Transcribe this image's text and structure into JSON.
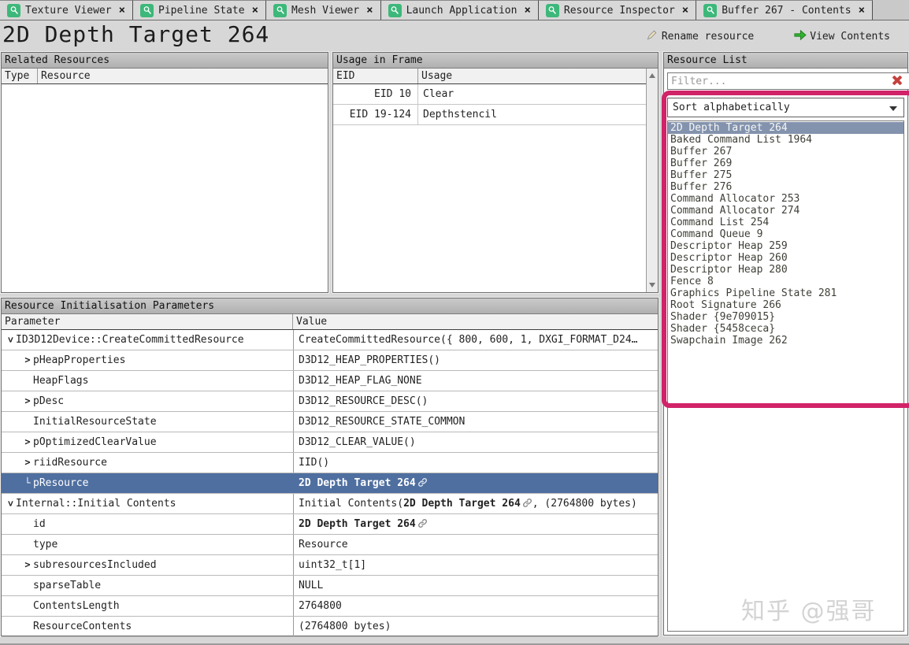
{
  "window": {
    "tabs": [
      {
        "label": "Texture Viewer"
      },
      {
        "label": "Pipeline State"
      },
      {
        "label": "Mesh Viewer"
      },
      {
        "label": "Launch Application"
      },
      {
        "label": "Resource Inspector"
      },
      {
        "label": "Buffer 267 - Contents"
      }
    ],
    "close_glyph": "×"
  },
  "header": {
    "title": "2D Depth Target 264",
    "rename_label": "Rename resource",
    "view_label": "View Contents"
  },
  "related_resources": {
    "title": "Related Resources",
    "columns": [
      "Type",
      "Resource"
    ],
    "rows": []
  },
  "usage_in_frame": {
    "title": "Usage in Frame",
    "columns": [
      "EID",
      "Usage"
    ],
    "rows": [
      {
        "eid": "EID 10",
        "usage": "Clear"
      },
      {
        "eid": "EID 19-124",
        "usage": "Depthstencil"
      }
    ]
  },
  "resource_list": {
    "title": "Resource List",
    "filter_placeholder": "Filter...",
    "sort_selected": "Sort alphabetically",
    "selected_index": 0,
    "items": [
      "2D Depth Target 264",
      "Baked Command List 1964",
      "Buffer 267",
      "Buffer 269",
      "Buffer 275",
      "Buffer 276",
      "Command Allocator 253",
      "Command Allocator 274",
      "Command List 254",
      "Command Queue 9",
      "Descriptor Heap 259",
      "Descriptor Heap 260",
      "Descriptor Heap 280",
      "Fence 8",
      "Graphics Pipeline State 281",
      "Root Signature 266",
      "Shader {9e709015}",
      "Shader {5458ceca}",
      "Swapchain Image 262"
    ]
  },
  "init_params": {
    "title": "Resource Initialisation Parameters",
    "columns": [
      "Parameter",
      "Value"
    ],
    "rows": [
      {
        "expander": "down",
        "indent": 0,
        "param": "ID3D12Device::CreateCommittedResource",
        "value": [
          {
            "t": "CreateCommittedResource({ 800, 600, 1, DXGI_FORMAT_D24…"
          }
        ]
      },
      {
        "expander": "right",
        "indent": 1,
        "param": "pHeapProperties",
        "value": [
          {
            "t": "D3D12_HEAP_PROPERTIES()"
          }
        ]
      },
      {
        "expander": "",
        "indent": 1,
        "param": "HeapFlags",
        "value": [
          {
            "t": "D3D12_HEAP_FLAG_NONE"
          }
        ]
      },
      {
        "expander": "right",
        "indent": 1,
        "param": "pDesc",
        "value": [
          {
            "t": "D3D12_RESOURCE_DESC()"
          }
        ]
      },
      {
        "expander": "",
        "indent": 1,
        "param": "InitialResourceState",
        "value": [
          {
            "t": "D3D12_RESOURCE_STATE_COMMON"
          }
        ]
      },
      {
        "expander": "right",
        "indent": 1,
        "param": "pOptimizedClearValue",
        "value": [
          {
            "t": "D3D12_CLEAR_VALUE()"
          }
        ]
      },
      {
        "expander": "right",
        "indent": 1,
        "param": "riidResource",
        "value": [
          {
            "t": "IID()"
          }
        ]
      },
      {
        "expander": "elbow",
        "indent": 1,
        "param": "pResource",
        "selected": true,
        "value": [
          {
            "t": "2D Depth Target 264",
            "bold": true,
            "link": true
          }
        ]
      },
      {
        "expander": "down",
        "indent": 0,
        "param": "Internal::Initial Contents",
        "value": [
          {
            "t": "Initial Contents("
          },
          {
            "t": "2D Depth Target 264",
            "bold": true,
            "link": true
          },
          {
            "t": ", (2764800 bytes)"
          }
        ]
      },
      {
        "expander": "",
        "indent": 1,
        "param": "id",
        "value": [
          {
            "t": "2D Depth Target 264",
            "bold": true,
            "link": true
          }
        ]
      },
      {
        "expander": "",
        "indent": 1,
        "param": "type",
        "value": [
          {
            "t": "Resource"
          }
        ]
      },
      {
        "expander": "right",
        "indent": 1,
        "param": "subresourcesIncluded",
        "value": [
          {
            "t": "uint32_t[1]"
          }
        ]
      },
      {
        "expander": "",
        "indent": 1,
        "param": "sparseTable",
        "value": [
          {
            "t": "NULL"
          }
        ]
      },
      {
        "expander": "",
        "indent": 1,
        "param": "ContentsLength",
        "value": [
          {
            "t": "2764800"
          }
        ]
      },
      {
        "expander": "",
        "indent": 1,
        "param": "ResourceContents",
        "value": [
          {
            "t": "(2764800 bytes)"
          }
        ]
      }
    ]
  },
  "watermark": "知乎 @强哥",
  "colors": {
    "annotation_pink": "#d12368",
    "selected_row_blue": "#4f6fa0",
    "list_selected_gray_blue": "#8393ad",
    "tab_icon_green": "#3db87a",
    "view_arrow_green": "#2fb32f",
    "filter_clear_red": "#c5413d"
  }
}
